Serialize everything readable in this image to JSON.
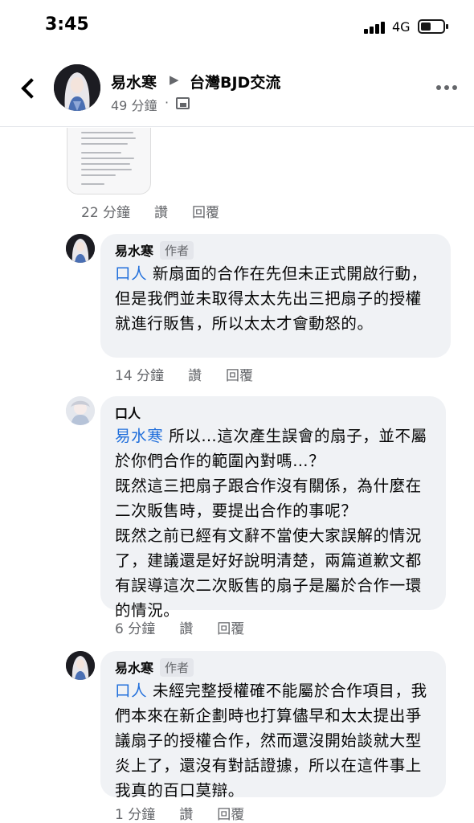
{
  "status": {
    "time": "3:45",
    "network": "4G"
  },
  "header": {
    "author": "易水寒",
    "group": "台灣BJD交流",
    "time_ago": "49 分鐘",
    "separator": "·"
  },
  "post_meta": {
    "time": "22 分鐘",
    "like": "讚",
    "reply": "回覆"
  },
  "comments": [
    {
      "author": "易水寒",
      "badge": "作者",
      "mention": "口人",
      "text": " 新扇面的合作在先但未正式開啟行動，但是我們並未取得太太先出三把扇子的授權就進行販售，所以太太才會動怒的。",
      "time": "14 分鐘",
      "like": "讚",
      "reply": "回覆"
    },
    {
      "author": "口人",
      "badge": "",
      "mention": "易水寒",
      "text": " 所以…這次產生誤會的扇子，並不屬於你們合作的範圍內對嗎…？\n既然這三把扇子跟合作沒有關係，為什麼在二次販售時，要提出合作的事呢？\n既然之前已經有文辭不當使大家誤解的情況了，建議還是好好說明清楚，兩篇道歉文都有誤導這次二次販售的扇子是屬於合作一環的情況。",
      "time": "6 分鐘",
      "like": "讚",
      "reply": "回覆"
    },
    {
      "author": "易水寒",
      "badge": "作者",
      "mention": "口人",
      "text": " 未經完整授權確不能屬於合作項目，我們本來在新企劃時也打算儘早和太太提出爭議扇子的授權合作，然而還沒開始談就大型炎上了，還沒有對話證據，所以在這件事上我真的百口莫辯。",
      "time": "1 分鐘",
      "like": "讚",
      "reply": "回覆"
    }
  ]
}
